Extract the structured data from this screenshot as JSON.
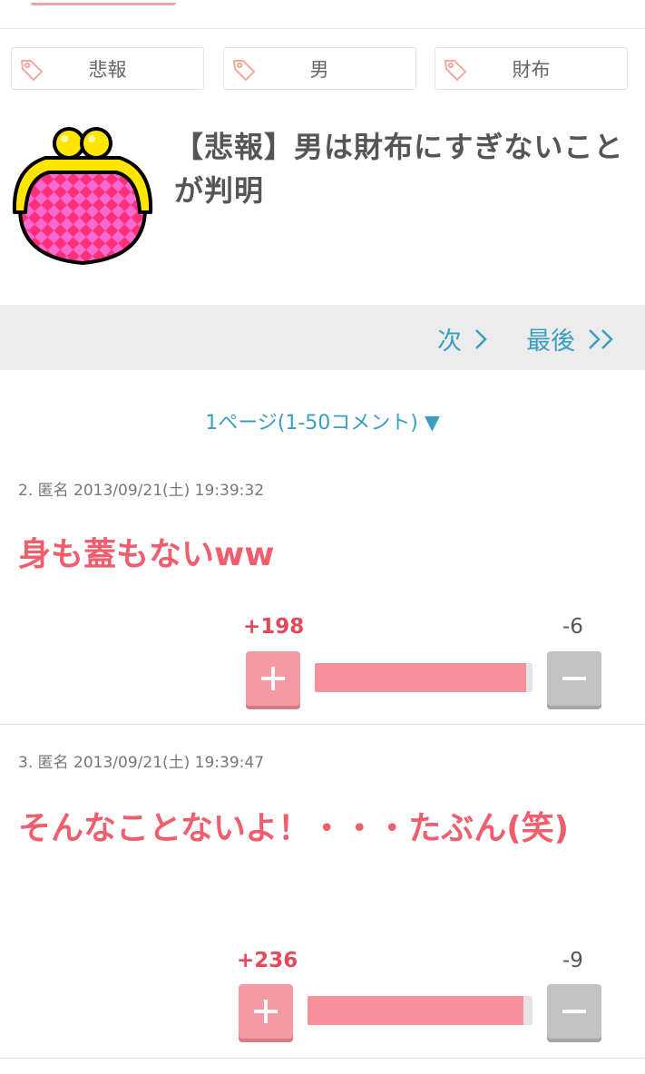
{
  "tags": [
    {
      "label": "悲報",
      "icon": "tag-icon"
    },
    {
      "label": "男",
      "icon": "tag-icon"
    },
    {
      "label": "財布",
      "icon": "tag-icon"
    }
  ],
  "article": {
    "title": "【悲報】男は財布にすぎないことが判明",
    "thumbnail": "coin-purse-image"
  },
  "pager": {
    "next_label": "次",
    "last_label": "最後"
  },
  "page_select": {
    "label": "1ページ(1-50コメント) ▼"
  },
  "comments": [
    {
      "meta": "2. 匿名 2013/09/21(土) 19:39:32",
      "text": "身も蓋もないww",
      "plus": "+198",
      "minus": "-6",
      "plus_ratio": 0.97
    },
    {
      "meta": "3. 匿名 2013/09/21(土) 19:39:47",
      "text": "そんなことないよ！・・・たぶん(笑)",
      "plus": "+236",
      "minus": "-9",
      "plus_ratio": 0.96
    }
  ],
  "colors": {
    "accent_link": "#3a9fbf",
    "comment_text": "#ef5e6c",
    "plus": "#f59aa2",
    "minus": "#c2c2c2"
  }
}
